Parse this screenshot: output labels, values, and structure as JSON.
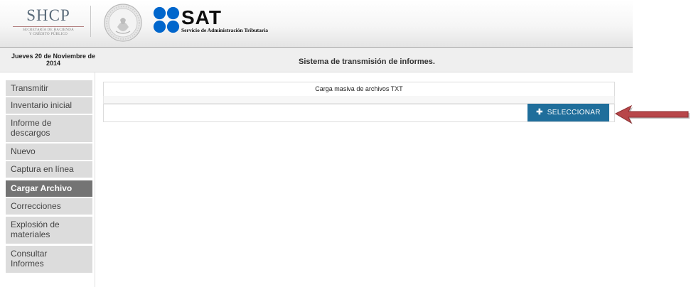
{
  "header": {
    "shcp_title": "SHCP",
    "shcp_subtitle_line1": "SECRETARÍA DE HACIENDA",
    "shcp_subtitle_line2": "Y CRÉDITO PÚBLICO",
    "sat_title": "SAT",
    "sat_subtitle": "Servicio de Administración Tributaria"
  },
  "infobar": {
    "date_line1": "Jueves 20 de Noviembre de",
    "date_line2": "2014",
    "page_title": "Sistema de transmisión de informes."
  },
  "sidebar": {
    "items": [
      {
        "line1": "Transmitir",
        "line2": ""
      },
      {
        "line1": "Inventario inicial",
        "line2": ""
      },
      {
        "line1": "Informe de",
        "line2": "descargos"
      },
      {
        "line1": "Nuevo",
        "line2": ""
      },
      {
        "line1": "Captura en línea",
        "line2": ""
      },
      {
        "line1": "Cargar Archivo",
        "line2": "",
        "active": true
      },
      {
        "line1": "Correcciones",
        "line2": ""
      },
      {
        "line1": "Explosión de",
        "line2": "materiales"
      },
      {
        "line1": "Consultar",
        "line2": "Informes"
      }
    ]
  },
  "main": {
    "panel_title": "Carga masiva de archivos TXT",
    "select_button": "SELECCIONAR"
  },
  "colors": {
    "button_blue": "#1f6e9b",
    "arrow_red": "#b8474a",
    "active_nav": "#747474",
    "sat_blue": "#0066cc"
  }
}
